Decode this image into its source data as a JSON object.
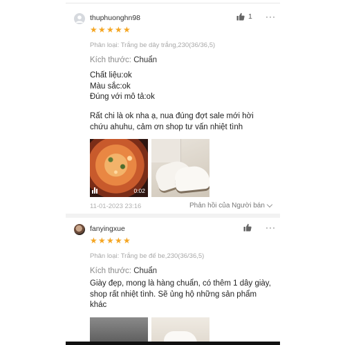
{
  "reviews": [
    {
      "username": "thuphuonghn98",
      "likes": "1",
      "variation": "Phân loại: Trắng be dây trắng,230(36/36,5)",
      "size_key": "Kích thước:",
      "size_value": "Chuẩn",
      "attrs": [
        "Chất liệu:ok",
        "Màu sắc:ok",
        "Đúng với mô tả:ok"
      ],
      "comment": "Rất chi là ok nha ạ, nua đúng đợt sale mới hời chứu ahuhu, cảm ơn shop tư vấn nhiệt tình",
      "video_duration": "0:02",
      "date": "11-01-2023 23:16",
      "seller_reply": "Phản hồi của Người bán"
    },
    {
      "username": "fanyingxue",
      "likes": "",
      "variation": "Phân loại: Trắng be đế be,230(36/36,5)",
      "size_key": "Kích thước:",
      "size_value": "Chuẩn",
      "comment": "Giày đẹp, mong là hàng chuẩn, có thêm 1 dây giày, shop rất nhiệt tình. Sẽ ủng hộ những sản phẩm khác"
    }
  ],
  "icons": {
    "star": "★",
    "more": "···"
  },
  "colors": {
    "star": "#f5a623",
    "muted": "#a8a8a8"
  },
  "rating": 5
}
